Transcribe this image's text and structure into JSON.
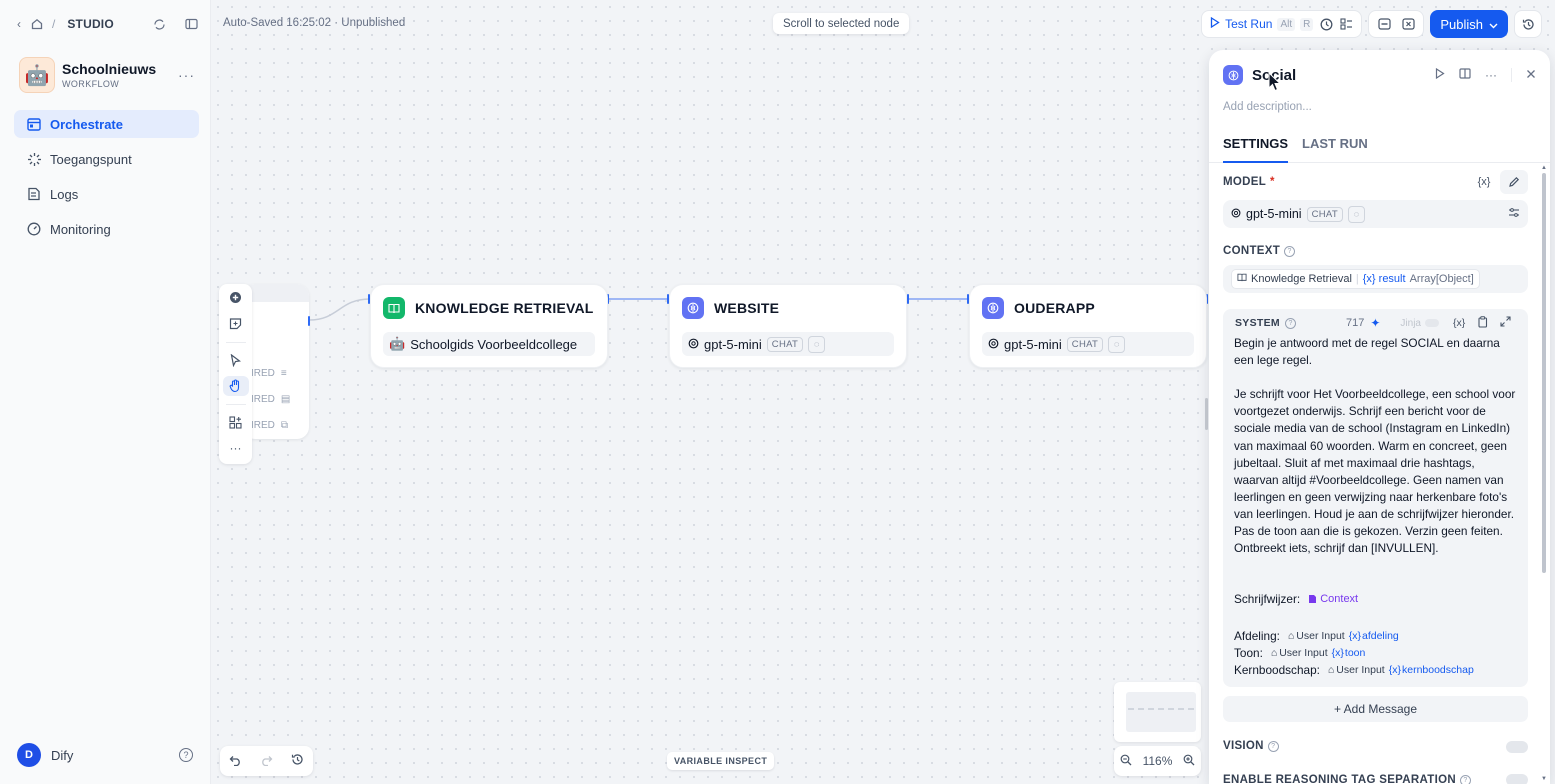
{
  "breadcrumb": {
    "studio": "STUDIO"
  },
  "app": {
    "name": "Schoolnieuws",
    "type": "WORKFLOW",
    "avatar": "🤖"
  },
  "nav": [
    {
      "label": "Orchestrate",
      "icon": "orchestrate-icon",
      "active": true
    },
    {
      "label": "Toegangspunt",
      "icon": "access-point-icon",
      "active": false
    },
    {
      "label": "Logs",
      "icon": "logs-icon",
      "active": false
    },
    {
      "label": "Monitoring",
      "icon": "monitoring-icon",
      "active": false
    }
  ],
  "user": {
    "initial": "D",
    "name": "Dify"
  },
  "canvas": {
    "autosave": "Auto-Saved 16:25:02 · Unpublished",
    "scroll_hint": "Scroll to selected node",
    "variable_inspect": "VARIABLE INSPECT",
    "zoom": "116%",
    "start_rows": [
      "IRED",
      "IRED",
      "IRED"
    ]
  },
  "toolbar": {
    "test_run": "Test Run",
    "test_run_kbd_1": "Alt",
    "test_run_kbd_2": "R",
    "publish": "Publish"
  },
  "nodes": [
    {
      "title": "KNOWLEDGE RETRIEVAL",
      "badge_color": "#12b76a",
      "body": "Schoolgids Voorbeeldcollege",
      "body_icon": "🤖"
    },
    {
      "title": "WEBSITE",
      "badge_color": "#6172f3",
      "model": "gpt-5-mini",
      "chip": "CHAT"
    },
    {
      "title": "OUDERAPP",
      "badge_color": "#6172f3",
      "model": "gpt-5-mini",
      "chip": "CHAT"
    }
  ],
  "panel": {
    "title": "Social",
    "description_placeholder": "Add description...",
    "tabs": [
      "SETTINGS",
      "LAST RUN"
    ],
    "model_label": "MODEL",
    "model_required": "*",
    "model_var_btn": "{x}",
    "model_name": "gpt-5-mini",
    "model_chip": "CHAT",
    "context_label": "CONTEXT",
    "context_source": "Knowledge Retrieval",
    "context_var": "{x} result",
    "context_type": "Array[Object]",
    "system_label": "SYSTEM",
    "system_count": "717",
    "system_jinja": "Jinja",
    "system_var_btn": "{x}",
    "system_text": "Begin je antwoord met de regel SOCIAL en daarna een lege regel.\n\nJe schrijft voor Het Voorbeeldcollege, een school voor voortgezet onderwijs. Schrijf een bericht voor de sociale media van de school (Instagram en LinkedIn) van maximaal 60 woorden. Warm en concreet, geen jubeltaal. Sluit af met maximaal drie hashtags, waarvan altijd #Voorbeeldcollege. Geen namen van leerlingen en geen verwijzing naar herkenbare foto's van leerlingen. Houd je aan de schrijfwijzer hieronder. Pas de toon aan die is gekozen. Verzin geen feiten. Ontbreekt iets, schrijf dan [INVULLEN].",
    "schrijfwijzer_label": "Schrijfwijzer:",
    "context_chip": "Context",
    "vars": [
      {
        "label": "Afdeling:",
        "source": "User Input",
        "var": "afdeling"
      },
      {
        "label": "Toon:",
        "source": "User Input",
        "var": "toon"
      },
      {
        "label": "Kernboodschap:",
        "source": "User Input",
        "var": "kernboodschap"
      }
    ],
    "var_prefix": "{x}",
    "add_message": "+ Add Message",
    "vision_label": "VISION",
    "reasoning_label": "ENABLE REASONING TAG SEPARATION"
  }
}
